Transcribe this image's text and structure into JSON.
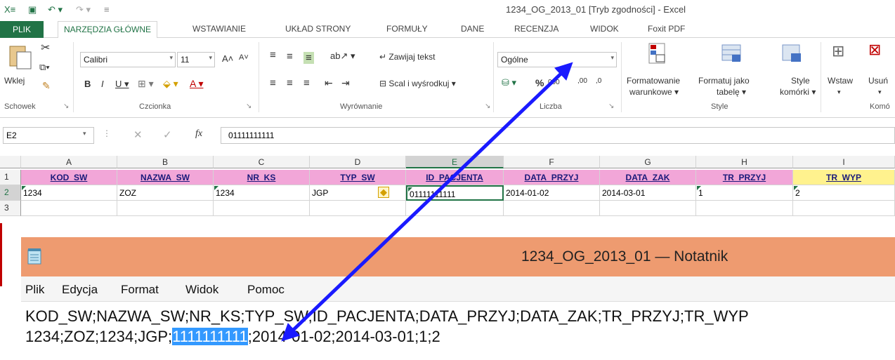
{
  "excel": {
    "window_title": "1234_OG_2013_01 [Tryb zgodności] - Excel",
    "tabs": [
      "PLIK",
      "NARZĘDZIA GŁÓWNE",
      "WSTAWIANIE",
      "UKŁAD STRONY",
      "FORMUŁY",
      "DANE",
      "RECENZJA",
      "WIDOK",
      "Foxit PDF"
    ],
    "active_tab": "NARZĘDZIA GŁÓWNE",
    "ribbon": {
      "paste_label": "Wklej",
      "clipboard_group": "Schowek",
      "font_name": "Calibri",
      "font_size": "11",
      "font_group": "Czcionka",
      "wrap_text": "Zawijaj tekst",
      "merge_center": "Scal i wyśrodkuj",
      "alignment_group": "Wyrównanie",
      "number_format": "Ogólne",
      "number_group": "Liczba",
      "percent": "%",
      "thousands": "000",
      "inc_decimal": ",00",
      "dec_decimal": ",0",
      "cond_format_1": "Formatowanie",
      "cond_format_2": "warunkowe",
      "format_table_1": "Formatuj jako",
      "format_table_2": "tabelę",
      "cell_styles_1": "Style",
      "cell_styles_2": "komórki",
      "styles_group": "Style",
      "insert": "Wstaw",
      "delete": "Usuń",
      "cells_group": "Komó"
    },
    "name_box": "E2",
    "formula": "01111111111",
    "columns": [
      "A",
      "B",
      "C",
      "D",
      "E",
      "F",
      "G",
      "H",
      "I"
    ],
    "rows": [
      "1",
      "2",
      "3"
    ],
    "header_row": [
      "KOD_SW",
      "NAZWA_SW",
      "NR_KS",
      "TYP_SW",
      "ID_PACJENTA",
      "DATA_PRZYJ",
      "DATA_ZAK",
      "TR_PRZYJ",
      "TR_WYP"
    ],
    "data_row": [
      "1234",
      "ZOZ",
      "1234",
      "JGP",
      "01111111111",
      "2014-01-02",
      "2014-03-01",
      "1",
      "2"
    ]
  },
  "notepad": {
    "title": "1234_OG_2013_01 — Notatnik",
    "menu": [
      "Plik",
      "Edycja",
      "Format",
      "Widok",
      "Pomoc"
    ],
    "line1": "KOD_SW;NAZWA_SW;NR_KS;TYP_SW;ID_PACJENTA;DATA_PRZYJ;DATA_ZAK;TR_PRZYJ;TR_WYP",
    "line2_before": "1234;ZOZ;1234;JGP;",
    "line2_selected": "1111111111",
    "line2_after": ";2014-01-02;2014-03-01;1;2"
  },
  "colors": {
    "excel_green": "#217346",
    "header_pink": "#f2a6d8",
    "header_yellow": "#fff28e",
    "notepad_title": "#ee9b70",
    "arrow_blue": "#1a1aff",
    "selection": "#3399ff"
  }
}
